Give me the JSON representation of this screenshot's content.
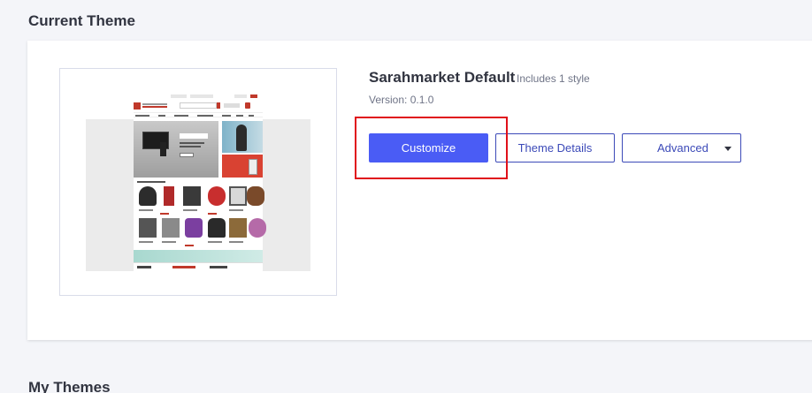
{
  "sections": {
    "current_theme_title": "Current Theme",
    "my_themes_title": "My Themes"
  },
  "theme": {
    "name": "Sarahmarket Default",
    "styles_note": "Includes 1 style",
    "version": "Version: 0.1.0",
    "preview_image": "store-preview-thumbnail"
  },
  "actions": {
    "customize_label": "Customize",
    "details_label": "Theme Details",
    "advanced_label": "Advanced",
    "advanced_icon": "chevron-down-icon"
  },
  "colors": {
    "primary": "#4a5cf5",
    "outline": "#3c4ab8",
    "highlight": "#e0101a",
    "background": "#f4f5f9"
  }
}
